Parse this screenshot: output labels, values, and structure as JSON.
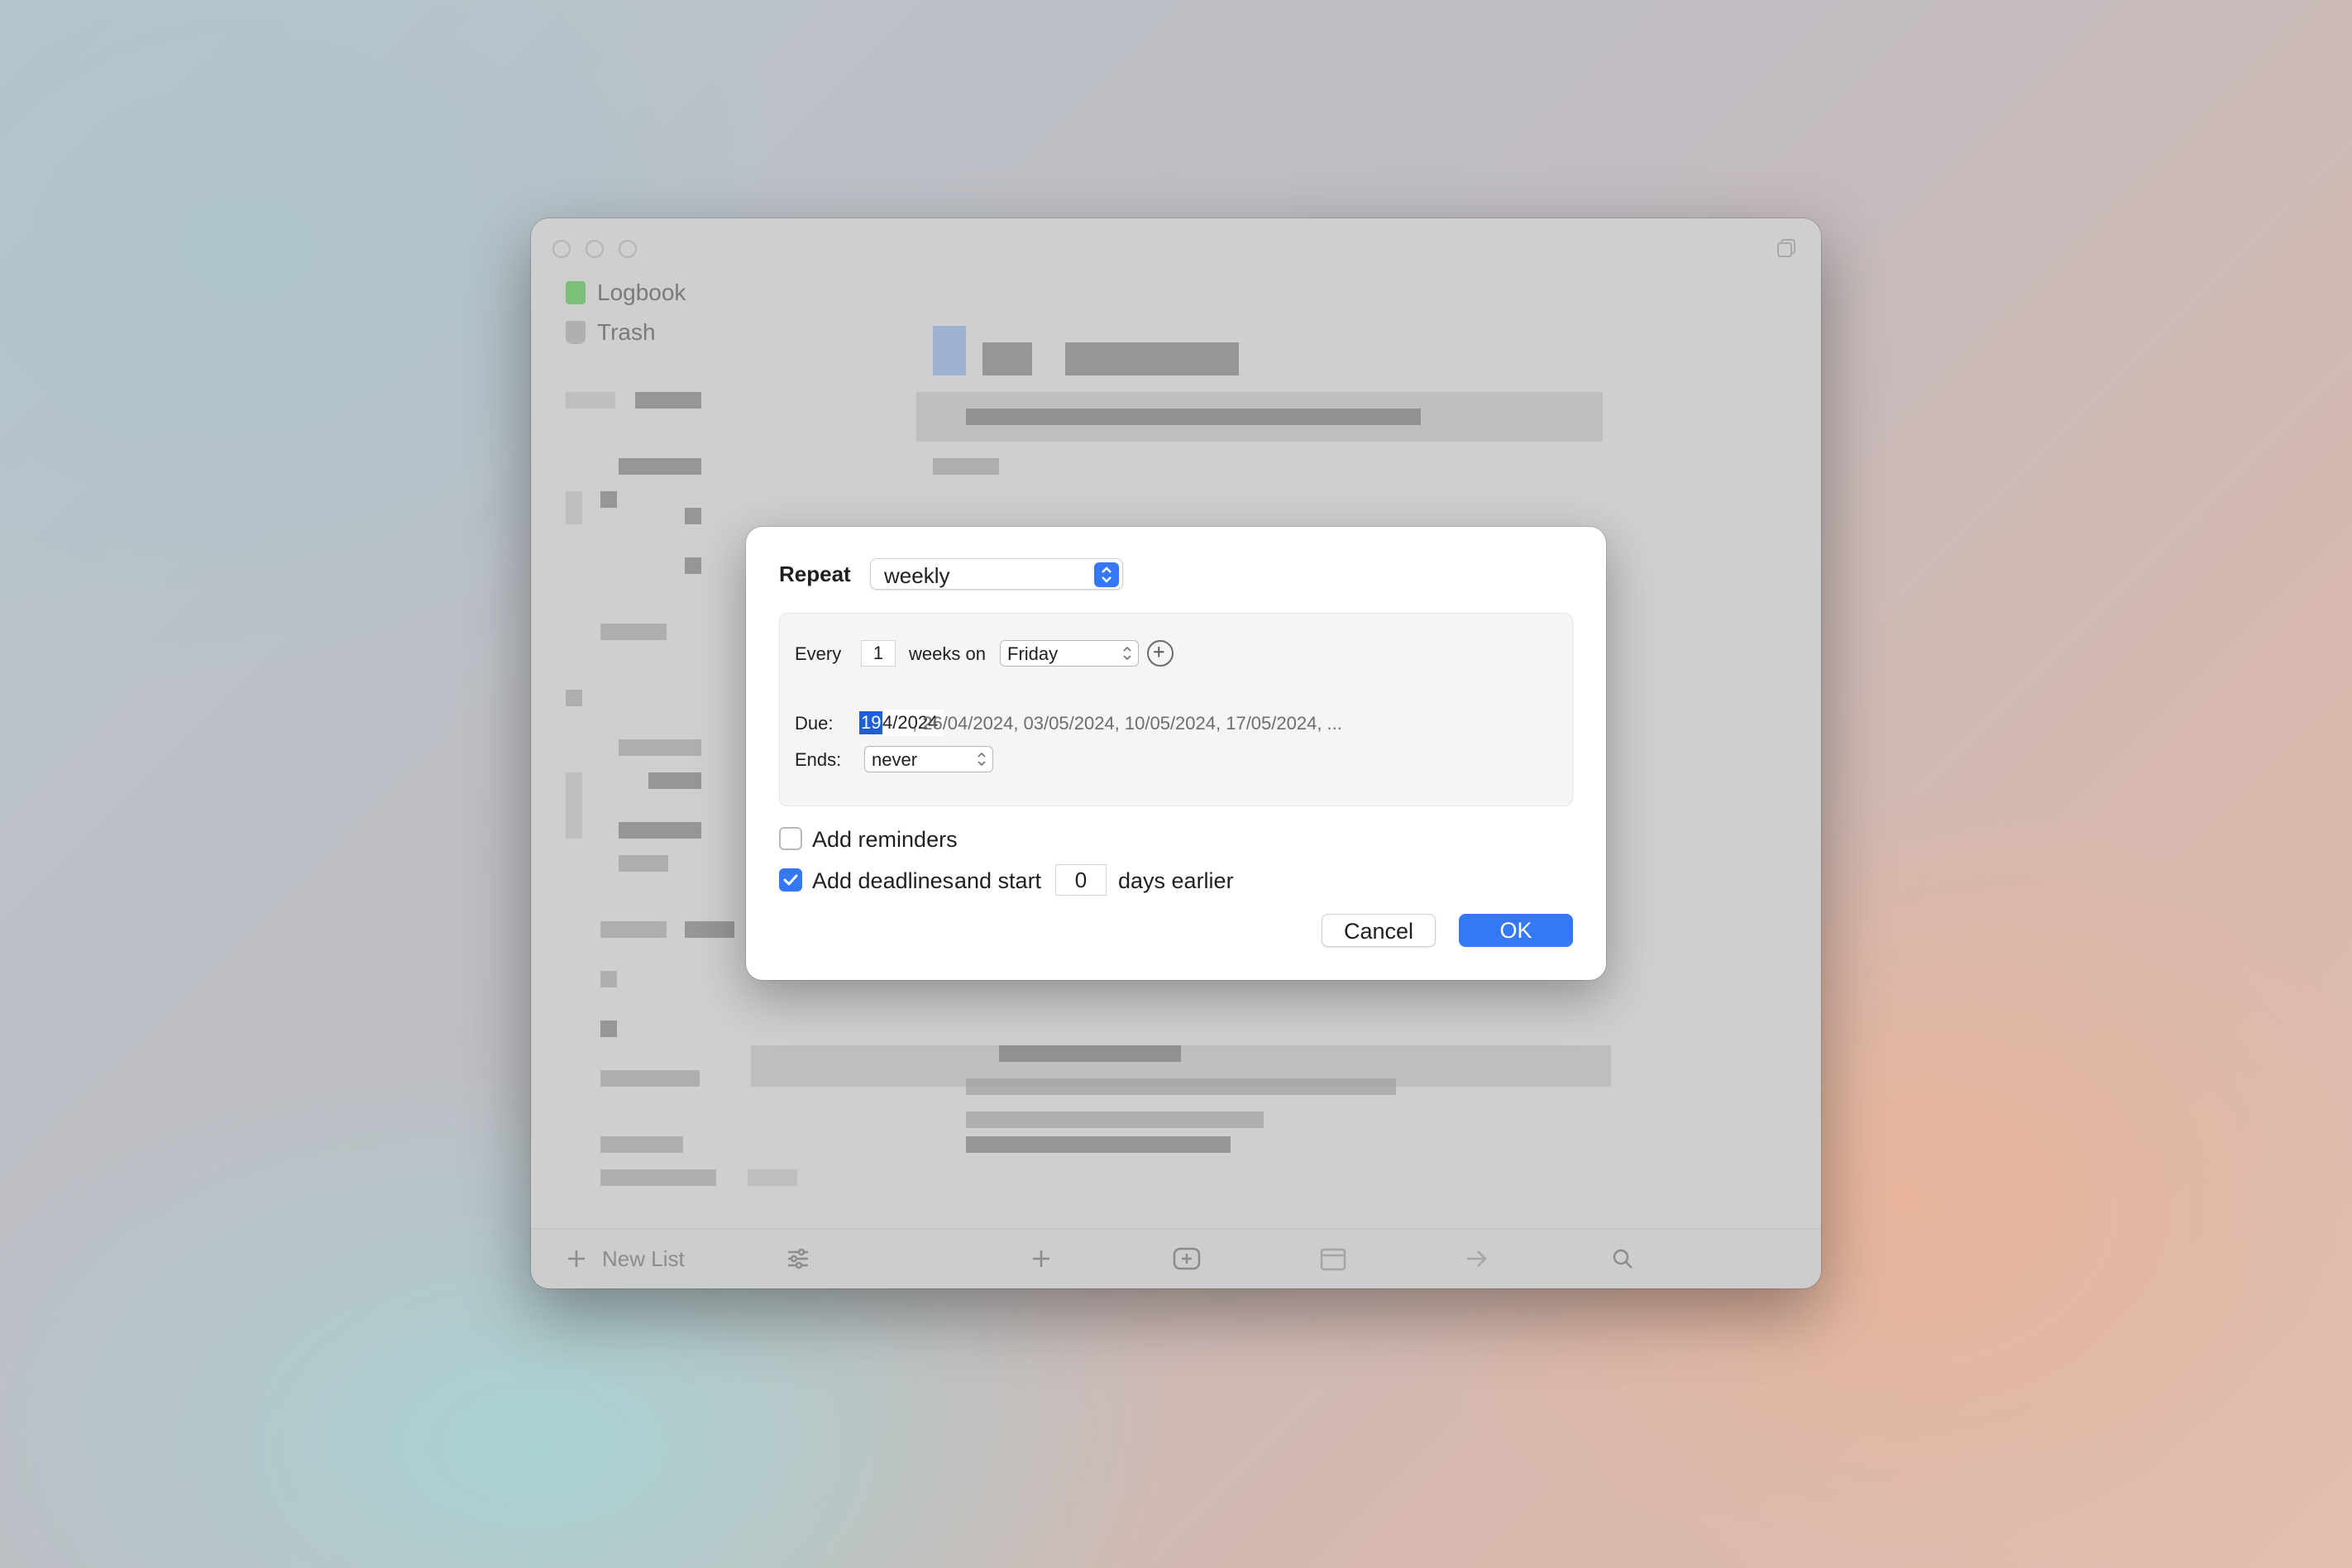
{
  "sidebar": {
    "items": [
      {
        "label": "Logbook",
        "icon": "logbook-icon",
        "color": "#5fae5f"
      },
      {
        "label": "Trash",
        "icon": "trash-icon"
      }
    ]
  },
  "bottom_toolbar": {
    "new_list_label": "New List"
  },
  "dialog": {
    "repeat_label": "Repeat",
    "repeat_value": "weekly",
    "every_label": "Every",
    "every_value": "1",
    "weeks_on_label": "weeks on",
    "weekday_value": "Friday",
    "due_label": "Due:",
    "due_day": "19",
    "due_rest": "4/2024",
    "upcoming_dates": ",  26/04/2024,  03/05/2024,  10/05/2024,  17/05/2024,  ...",
    "ends_label": "Ends:",
    "ends_value": "never",
    "add_reminders_label": "Add reminders",
    "add_reminders_checked": false,
    "add_deadlines_label": "Add deadlines",
    "add_deadlines_checked": true,
    "and_start_label": "and start",
    "days_value": "0",
    "days_earlier_label": "days earlier",
    "cancel_label": "Cancel",
    "ok_label": "OK",
    "accent_color": "#3478f6"
  }
}
